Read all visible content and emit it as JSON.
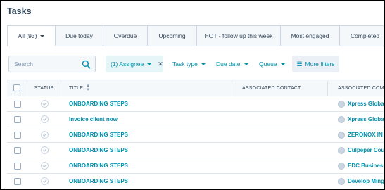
{
  "page": {
    "title": "Tasks"
  },
  "tabs": [
    {
      "label": "All (93)",
      "active": true
    },
    {
      "label": "Due today"
    },
    {
      "label": "Overdue"
    },
    {
      "label": "Upcoming"
    },
    {
      "label": "HOT - follow up this week"
    },
    {
      "label": "Most engaged"
    },
    {
      "label": "Completed"
    }
  ],
  "filters": {
    "search_placeholder": "Search",
    "assignee": "(1) Assignee",
    "task_type": "Task type",
    "due_date": "Due date",
    "queue": "Queue",
    "more_filters": "More filters"
  },
  "table": {
    "headers": {
      "status": "STATUS",
      "title": "TITLE",
      "contact": "ASSOCIATED CONTACT",
      "company": "ASSOCIATED COMPA"
    },
    "rows": [
      {
        "title": "ONBOARDING STEPS",
        "contact": "",
        "company": "Xpress Global"
      },
      {
        "title": "Invoice client now",
        "contact": "",
        "company": "Xpress Global"
      },
      {
        "title": "ONBOARDING STEPS",
        "contact": "",
        "company": "ZERONOX IN"
      },
      {
        "title": "ONBOARDING STEPS",
        "contact": "",
        "company": "Culpeper Cou"
      },
      {
        "title": "ONBOARDING STEPS",
        "contact": "",
        "company": "EDC Business"
      },
      {
        "title": "ONBOARDING STEPS",
        "contact": "",
        "company": "Develop Ming"
      }
    ]
  },
  "colors": {
    "link": "#0091ae",
    "text": "#33475b",
    "border": "#cbd6e2"
  }
}
